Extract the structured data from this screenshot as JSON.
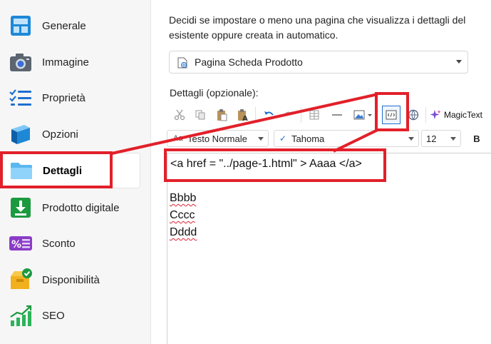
{
  "sidebar": {
    "items": [
      {
        "label": "Generale",
        "icon": "layout-icon"
      },
      {
        "label": "Immagine",
        "icon": "camera-icon"
      },
      {
        "label": "Proprietà",
        "icon": "list-icon"
      },
      {
        "label": "Opzioni",
        "icon": "layers-icon"
      },
      {
        "label": "Dettagli",
        "icon": "folder-icon"
      },
      {
        "label": "Prodotto digitale",
        "icon": "download-icon"
      },
      {
        "label": "Sconto",
        "icon": "percent-icon"
      },
      {
        "label": "Disponibilità",
        "icon": "stock-check-icon"
      },
      {
        "label": "SEO",
        "icon": "chart-up-icon"
      }
    ],
    "active_index": 4
  },
  "main": {
    "description_line1": "Decidi se impostare o meno una pagina che visualizza i dettagli del",
    "description_line2": "esistente oppure creata in automatico.",
    "page_select_value": "Pagina Scheda Prodotto",
    "details_label": "Dettagli (opzionale):",
    "toolbar": {
      "magic_label": "MagicText"
    },
    "format": {
      "style_value": "Testo Normale",
      "style_prefix": "Aa",
      "font_value": "Tahoma",
      "size_value": "12",
      "bold_label": "B"
    },
    "editor": {
      "code_line": "<a href = \"../page-1.html\" > Aaaa </a>",
      "lines": [
        " Bbbb",
        "Cccc",
        "Dddd"
      ]
    }
  },
  "colors": {
    "annotation_red": "#e2202a",
    "accent_blue": "#1f6fd1"
  }
}
